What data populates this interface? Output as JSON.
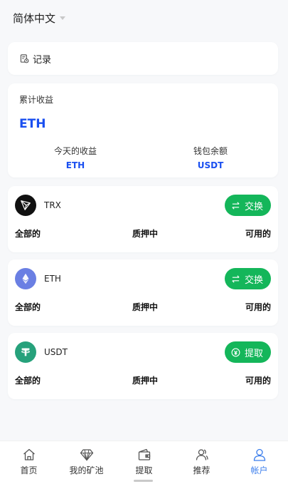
{
  "header": {
    "language": "简体中文"
  },
  "records": {
    "label": "记录"
  },
  "earnings": {
    "total_label": "累计收益",
    "total_value": "ETH",
    "today_label": "今天的收益",
    "today_value": "ETH",
    "wallet_label": "钱包余额",
    "wallet_value": "USDT"
  },
  "coins": [
    {
      "name": "TRX",
      "action": "交换",
      "total": "全部的",
      "staked": "质押中",
      "available": "可用的"
    },
    {
      "name": "ETH",
      "action": "交换",
      "total": "全部的",
      "staked": "质押中",
      "available": "可用的"
    },
    {
      "name": "USDT",
      "action": "提取",
      "total": "全部的",
      "staked": "质押中",
      "available": "可用的"
    }
  ],
  "tabs": [
    {
      "label": "首页",
      "icon": "home-icon"
    },
    {
      "label": "我的矿池",
      "icon": "diamond-icon"
    },
    {
      "label": "提取",
      "icon": "wallet-icon"
    },
    {
      "label": "推荐",
      "icon": "users-icon"
    },
    {
      "label": "帐户",
      "icon": "user-icon"
    }
  ],
  "colors": {
    "accent": "#1a4ff0",
    "button": "#14b65a",
    "active_tab": "#3a7dec"
  }
}
